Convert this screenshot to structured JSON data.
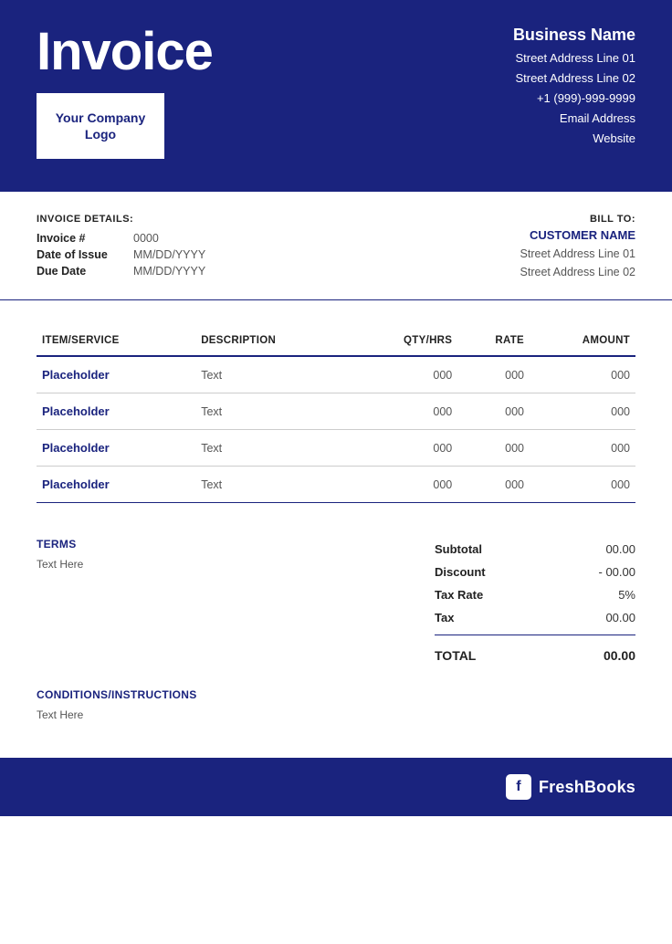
{
  "header": {
    "title": "Invoice",
    "logo_text": "Your Company Logo",
    "business": {
      "name": "Business Name",
      "address_line1": "Street Address Line 01",
      "address_line2": "Street Address Line 02",
      "phone": "+1 (999)-999-9999",
      "email": "Email Address",
      "website": "Website"
    }
  },
  "invoice_details": {
    "section_label": "INVOICE DETAILS:",
    "fields": [
      {
        "key": "Invoice #",
        "value": "0000"
      },
      {
        "key": "Date of Issue",
        "value": "MM/DD/YYYY"
      },
      {
        "key": "Due Date",
        "value": "MM/DD/YYYY"
      }
    ]
  },
  "bill_to": {
    "label": "BILL TO:",
    "customer_name": "CUSTOMER NAME",
    "address_line1": "Street Address Line 01",
    "address_line2": "Street Address Line 02"
  },
  "table": {
    "columns": [
      "ITEM/SERVICE",
      "DESCRIPTION",
      "QTY/HRS",
      "RATE",
      "AMOUNT"
    ],
    "rows": [
      {
        "item": "Placeholder",
        "description": "Text",
        "qty": "000",
        "rate": "000",
        "amount": "000"
      },
      {
        "item": "Placeholder",
        "description": "Text",
        "qty": "000",
        "rate": "000",
        "amount": "000"
      },
      {
        "item": "Placeholder",
        "description": "Text",
        "qty": "000",
        "rate": "000",
        "amount": "000"
      },
      {
        "item": "Placeholder",
        "description": "Text",
        "qty": "000",
        "rate": "000",
        "amount": "000"
      }
    ]
  },
  "terms": {
    "label": "TERMS",
    "text": "Text Here"
  },
  "totals": {
    "subtotal_label": "Subtotal",
    "subtotal_value": "00.00",
    "discount_label": "Discount",
    "discount_value": "- 00.00",
    "tax_rate_label": "Tax Rate",
    "tax_rate_value": "5%",
    "tax_label": "Tax",
    "tax_value": "00.00",
    "total_label": "TOTAL",
    "total_value": "00.00"
  },
  "conditions": {
    "label": "CONDITIONS/INSTRUCTIONS",
    "text": "Text Here"
  },
  "footer": {
    "brand": "FreshBooks",
    "icon_letter": "f"
  }
}
